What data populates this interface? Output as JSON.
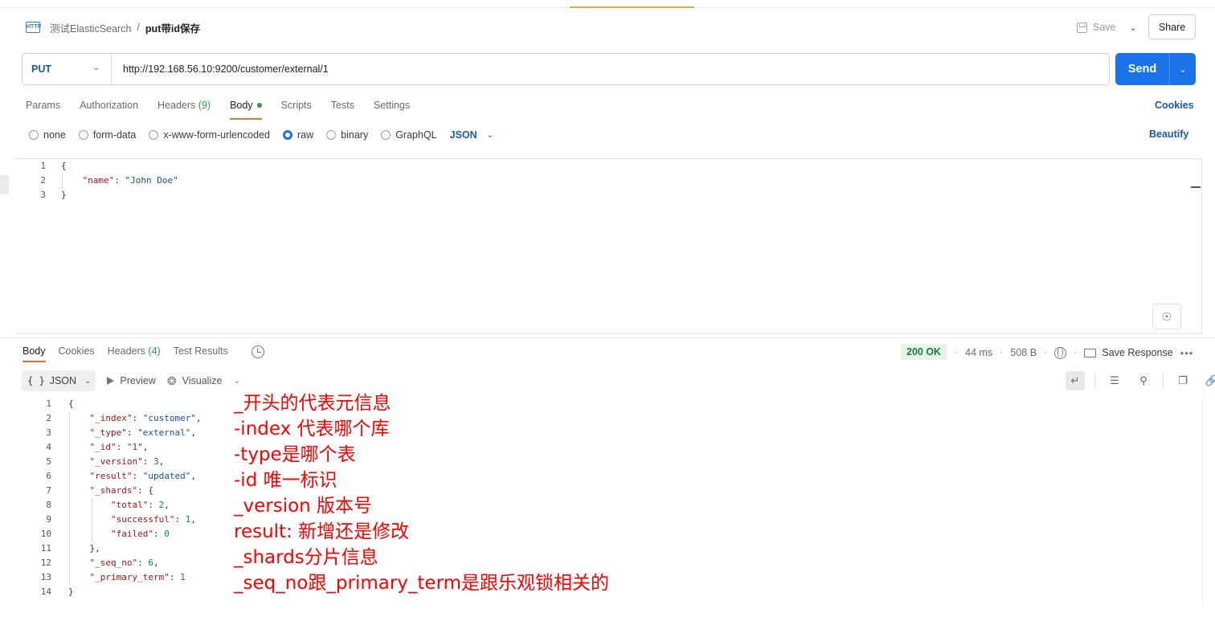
{
  "header": {
    "breadcrumb_parent": "测试ElasticSearch",
    "breadcrumb_separator": "/",
    "breadcrumb_current": "put带id保存",
    "http_badge": "HTTP",
    "save_label": "Save",
    "share_label": "Share"
  },
  "request": {
    "method": "PUT",
    "url": "http://192.168.56.10:9200/customer/external/1",
    "send_label": "Send"
  },
  "request_tabs": {
    "params": "Params",
    "authorization": "Authorization",
    "headers": "Headers",
    "headers_count": "(9)",
    "body": "Body",
    "scripts": "Scripts",
    "tests": "Tests",
    "settings": "Settings",
    "cookies_link": "Cookies"
  },
  "body_types": {
    "none": "none",
    "form_data": "form-data",
    "urlencoded": "x-www-form-urlencoded",
    "raw": "raw",
    "binary": "binary",
    "graphql": "GraphQL",
    "format": "JSON",
    "selected": "raw",
    "beautify_link": "Beautify"
  },
  "request_body": {
    "line_numbers": [
      "1",
      "2",
      "3"
    ],
    "open_brace": "{",
    "name_key": "\"name\"",
    "name_value": "\"John Doe\"",
    "close_brace": "}"
  },
  "response_tabs": {
    "body": "Body",
    "cookies": "Cookies",
    "headers": "Headers",
    "headers_count": "(4)",
    "test_results": "Test Results"
  },
  "response_meta": {
    "status": "200 OK",
    "time": "44 ms",
    "size": "508 B",
    "save_response": "Save Response"
  },
  "response_toolbar": {
    "format": "JSON",
    "format_braces": "{ }",
    "preview": "Preview",
    "visualize": "Visualize"
  },
  "response_body": {
    "lines": [
      {
        "n": "1",
        "text": "{"
      },
      {
        "n": "2",
        "key": "\"_index\"",
        "value": "\"customer\"",
        "type": "str",
        "comma": ","
      },
      {
        "n": "3",
        "key": "\"_type\"",
        "value": "\"external\"",
        "type": "str",
        "comma": ","
      },
      {
        "n": "4",
        "key": "\"_id\"",
        "value": "\"1\"",
        "type": "str",
        "comma": ","
      },
      {
        "n": "5",
        "key": "\"_version\"",
        "value": "3",
        "type": "num",
        "comma": ","
      },
      {
        "n": "6",
        "key": "\"result\"",
        "value": "\"updated\"",
        "type": "str",
        "comma": ","
      },
      {
        "n": "7",
        "key": "\"_shards\"",
        "value": "{",
        "type": "punc",
        "comma": ""
      },
      {
        "n": "8",
        "key": "\"total\"",
        "value": "2",
        "type": "num",
        "comma": ","
      },
      {
        "n": "9",
        "key": "\"successful\"",
        "value": "1",
        "type": "num",
        "comma": ","
      },
      {
        "n": "10",
        "key": "\"failed\"",
        "value": "0",
        "type": "num",
        "comma": ""
      },
      {
        "n": "11",
        "text": "},"
      },
      {
        "n": "12",
        "key": "\"_seq_no\"",
        "value": "6",
        "type": "num",
        "comma": ","
      },
      {
        "n": "13",
        "key": "\"_primary_term\"",
        "value": "1",
        "type": "num",
        "comma": ""
      },
      {
        "n": "14",
        "text": "}"
      }
    ]
  },
  "annotations": [
    "_开头的代表元信息",
    "-index 代表哪个库",
    "-type是哪个表",
    "-id 唯一标识",
    "_version 版本号",
    "result: 新增还是修改",
    "_shards分片信息",
    "_seq_no跟_primary_term是跟乐观锁相关的"
  ],
  "colors": {
    "accent_blue": "#1a73e8",
    "tab_underline": "#e8722a",
    "status_green": "#1f7a3a",
    "annotation_red": "#ff0000"
  }
}
